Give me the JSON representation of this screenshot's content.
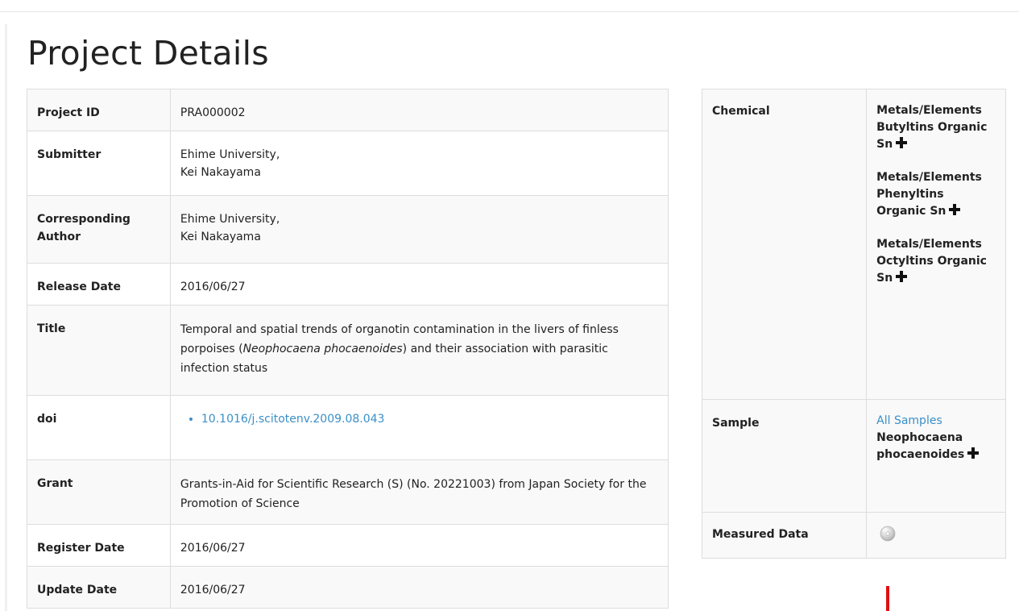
{
  "page_title": "Project Details",
  "details": {
    "project_id_label": "Project ID",
    "project_id": "PRA000002",
    "submitter_label": "Submitter",
    "submitter_line1": "Ehime University,",
    "submitter_line2": "Kei Nakayama",
    "corresponding_label_line1": "Corresponding",
    "corresponding_label_line2": "Author",
    "corresponding_line1": "Ehime University,",
    "corresponding_line2": "Kei Nakayama",
    "release_date_label": "Release Date",
    "release_date": "2016/06/27",
    "title_label": "Title",
    "title_part1": "Temporal and spatial trends of organotin contamination in the livers of finless porpoises (",
    "title_species": "Neophocaena phocaenoides",
    "title_part2": ") and their association with parasitic infection status",
    "doi_label": "doi",
    "doi_link": "10.1016/j.scitotenv.2009.08.043",
    "grant_label": "Grant",
    "grant": "Grants-in-Aid for Scientific Research (S) (No. 20221003) from Japan Society for the Promotion of Science",
    "register_date_label": "Register Date",
    "register_date": "2016/06/27",
    "update_date_label": "Update Date",
    "update_date": "2016/06/27"
  },
  "side": {
    "chemical_label": "Chemical",
    "chemicals": [
      "Metals/Elements Butyltins Organic Sn",
      "Metals/Elements Phenyltins Organic Sn",
      "Metals/Elements Octyltins Organic Sn"
    ],
    "sample_label": "Sample",
    "all_samples_link": "All Samples",
    "sample_species_line1": "Neophocaena",
    "sample_species_line2": "phocaenoides",
    "measured_data_label": "Measured Data"
  },
  "icons": {
    "expand": "plus-icon",
    "measured_data": "disc-icon"
  },
  "colors": {
    "link": "#3a8fc8",
    "row_alt": "#f9f9f9",
    "border": "#dddddd",
    "marker": "#e01010"
  }
}
